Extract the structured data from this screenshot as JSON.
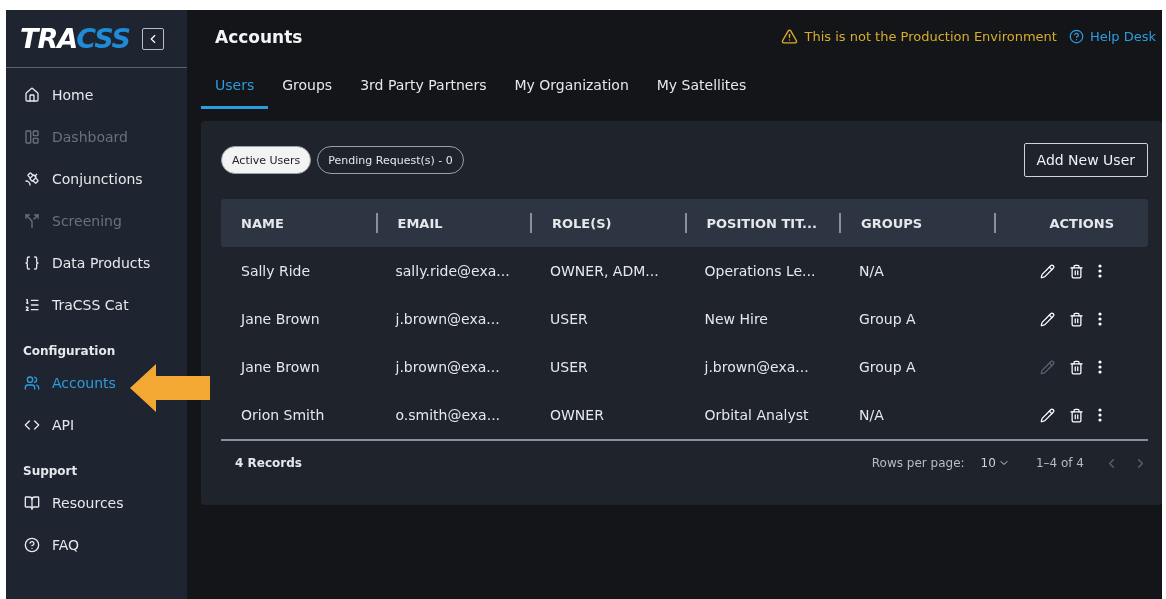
{
  "logo": {
    "lead": "TRA",
    "accent": "CSS"
  },
  "header": {
    "title": "Accounts",
    "warning": "This is not the Production Environment",
    "help": "Help Desk"
  },
  "sidebar": {
    "sections": [
      {
        "items": [
          {
            "label": "Home",
            "selected": false,
            "disabled": false
          },
          {
            "label": "Dashboard",
            "selected": false,
            "disabled": true
          },
          {
            "label": "Conjunctions",
            "selected": false,
            "disabled": false
          },
          {
            "label": "Screening",
            "selected": false,
            "disabled": true
          },
          {
            "label": "Data Products",
            "selected": false,
            "disabled": false
          },
          {
            "label": "TraCSS Cat",
            "selected": false,
            "disabled": false
          }
        ]
      },
      {
        "heading": "Configuration",
        "items": [
          {
            "label": "Accounts",
            "selected": true,
            "disabled": false
          },
          {
            "label": "API",
            "selected": false,
            "disabled": false
          }
        ]
      },
      {
        "heading": "Support",
        "items": [
          {
            "label": "Resources",
            "selected": false,
            "disabled": false
          },
          {
            "label": "FAQ",
            "selected": false,
            "disabled": false
          }
        ]
      }
    ]
  },
  "tabs": [
    {
      "label": "Users",
      "selected": true
    },
    {
      "label": "Groups",
      "selected": false
    },
    {
      "label": "3rd Party Partners",
      "selected": false
    },
    {
      "label": "My Organization",
      "selected": false
    },
    {
      "label": "My Satellites",
      "selected": false
    }
  ],
  "filters": [
    {
      "label": "Active Users",
      "selected": true
    },
    {
      "label": "Pending Request(s) - 0",
      "selected": false
    }
  ],
  "add_button": "Add New User",
  "table": {
    "columns": [
      "NAME",
      "EMAIL",
      "ROLE(S)",
      "POSITION TIT...",
      "GROUPS",
      "ACTIONS"
    ],
    "rows": [
      {
        "cells": [
          "Sally Ride",
          "sally.ride@exa...",
          "OWNER, ADM...",
          "Operations Le...",
          "N/A"
        ],
        "edit_disabled": false
      },
      {
        "cells": [
          "Jane Brown",
          "j.brown@exa...",
          "USER",
          "New Hire",
          "Group A"
        ],
        "edit_disabled": false
      },
      {
        "cells": [
          "Jane Brown",
          "j.brown@exa...",
          "USER",
          "j.brown@exa...",
          "Group A"
        ],
        "edit_disabled": true
      },
      {
        "cells": [
          "Orion Smith",
          "o.smith@exa...",
          "OWNER",
          "Orbital Analyst",
          "N/A"
        ],
        "edit_disabled": false
      }
    ]
  },
  "footer": {
    "records": "4 Records",
    "rows_per_page_label": "Rows per page:",
    "rows_per_page": "10",
    "range": "1–4 of 4"
  }
}
